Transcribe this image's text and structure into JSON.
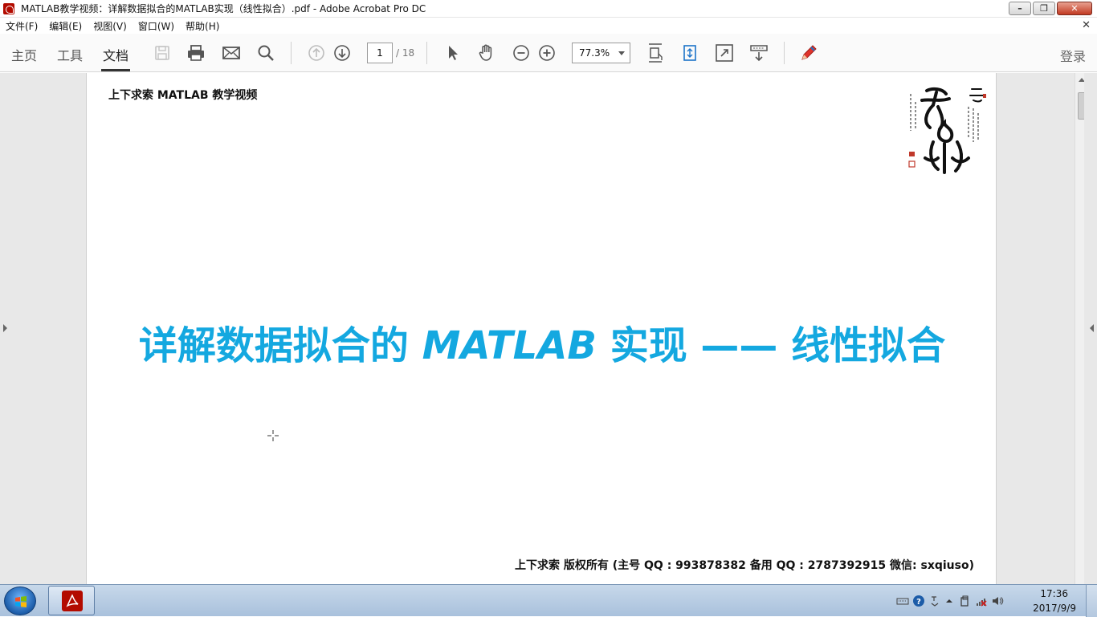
{
  "window": {
    "title": "MATLAB教学视频：详解数据拟合的MATLAB实现（线性拟合）.pdf - Adobe Acrobat Pro DC"
  },
  "menu": {
    "items": [
      "文件(F)",
      "编辑(E)",
      "视图(V)",
      "窗口(W)",
      "帮助(H)"
    ]
  },
  "toolbar": {
    "tabs": [
      "主页",
      "工具",
      "文档"
    ],
    "active_tab": "文档",
    "page_current": "1",
    "page_total": "/ 18",
    "zoom": "77.3%",
    "login_label": "登录"
  },
  "document": {
    "header": "上下求索 MATLAB 教学视频",
    "title_part1": "详解数据拟合的 ",
    "title_latin": "MATLAB",
    "title_part2": " 实现 —— 线性拟合",
    "footer": "上下求索  版权所有  (主号 QQ : 993878382   备用 QQ : 2787392915   微信: sxqiuso)",
    "title_color": "#14a8e0"
  },
  "taskbar": {
    "time": "17:36",
    "date": "2017/9/9"
  },
  "icons": [
    "save-icon",
    "print-icon",
    "mail-icon",
    "search-icon",
    "page-up-icon",
    "page-down-icon",
    "select-arrow-icon",
    "hand-icon",
    "zoom-out-icon",
    "zoom-in-icon",
    "fit-page-icon",
    "rotate-icon",
    "fullscreen-icon",
    "scroll-mode-icon",
    "pen-icon"
  ]
}
